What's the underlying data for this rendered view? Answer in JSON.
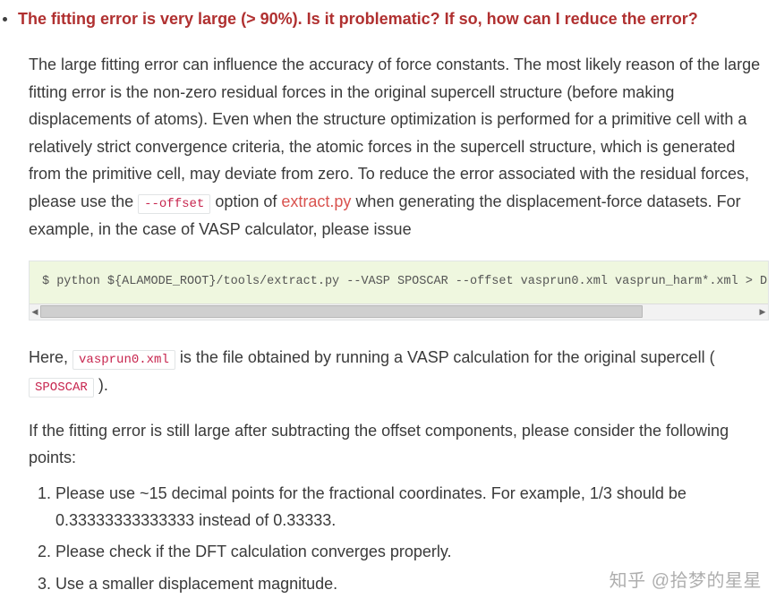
{
  "faq": {
    "heading": "The fitting error is very large (> 90%). Is it problematic? If so, how can I reduce the error?",
    "para1_a": "The large fitting error can influence the accuracy of force constants. The most likely reason of the large fitting error is the non-zero residual forces in the original supercell structure (before making displacements of atoms). Even when the structure optimization is performed for a primitive cell with a relatively strict convergence criteria, the atomic forces in the supercell structure, which is generated from the primitive cell, may deviate from zero. To reduce the error associated with the residual forces, please use the ",
    "offset_flag": "--offset",
    "para1_b": " option of ",
    "extract_py": "extract.py",
    "para1_c": " when generating the displacement-force datasets. For example, in the case of VASP calculator, please issue",
    "code": "$ python ${ALAMODE_ROOT}/tools/extract.py --VASP SPOSCAR --offset vasprun0.xml vasprun_harm*.xml > D",
    "para2_a": "Here, ",
    "vasprun0": "vasprun0.xml",
    "para2_b": " is the file obtained by running a VASP calculation for the original supercell ( ",
    "sposcar": "SPOSCAR",
    "para2_c": " ).",
    "para3": "If the fitting error is still large after subtracting the offset components, please consider the following points:",
    "points": [
      "Please use ~15 decimal points for the fractional coordinates. For example, 1/3 should be 0.33333333333333 instead of 0.33333.",
      "Please check if the DFT calculation converges properly.",
      "Use a smaller displacement magnitude."
    ]
  },
  "watermark": "知乎 @拾梦的星星"
}
